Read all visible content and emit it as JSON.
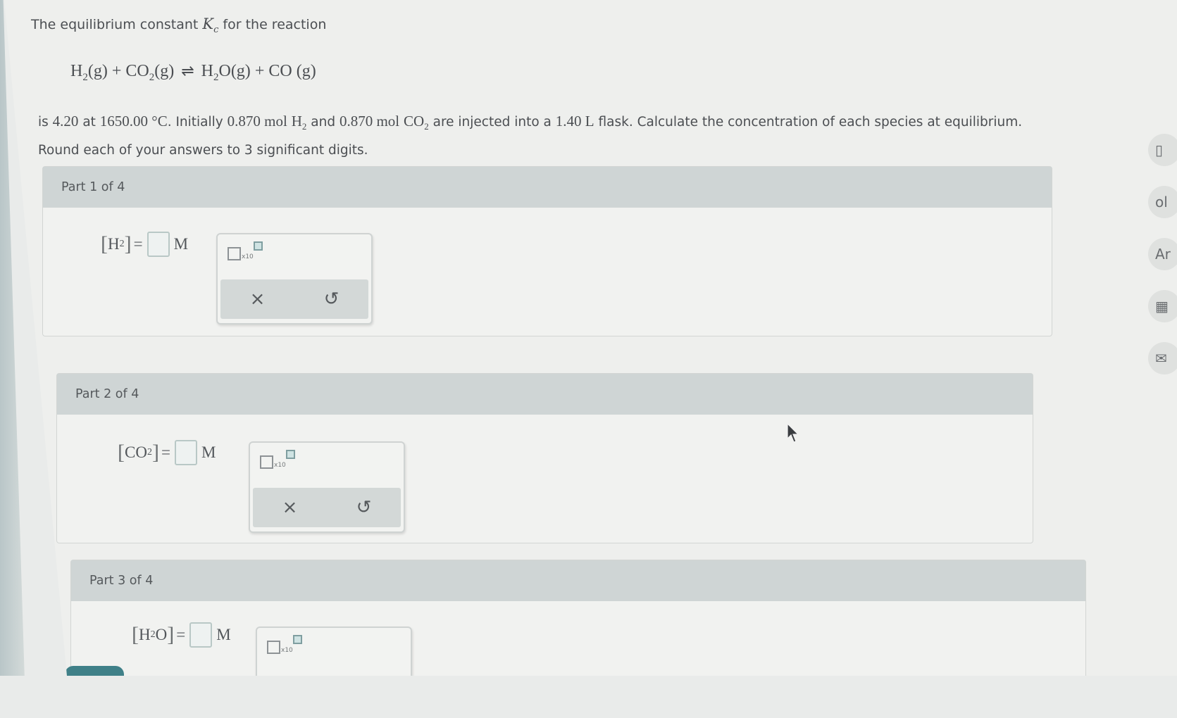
{
  "question": {
    "intro_before": "The equilibrium constant",
    "k_symbol": "K",
    "k_subscript": "c",
    "intro_after": "for the reaction",
    "equation": {
      "r1": "H",
      "r1_sub": "2",
      "r1_state": "(g)",
      "plus1": "+",
      "r2": "CO",
      "r2_sub": "2",
      "r2_state": "(g)",
      "arrow": "⇌",
      "p1": "H",
      "p1_sub": "2",
      "p1_rest": "O(g)",
      "plus2": "+",
      "p2": "CO (g)"
    },
    "line1": {
      "t1": "is",
      "kc_value": "4.20",
      "t2": "at",
      "temperature": "1650.00 °C",
      "t3": ". Initially",
      "h2_amount": "0.870 mol",
      "h2": "H",
      "h2_sub": "2",
      "t4": "and",
      "co2_amount": "0.870 mol",
      "co2": "CO",
      "co2_sub": "2",
      "t5": "are injected into a",
      "volume": "1.40 L",
      "t6": "flask. Calculate the concentration of each species at equilibrium."
    },
    "line2": "Round each of your answers to 3 significant digits."
  },
  "parts": [
    {
      "header": "Part 1 of 4",
      "species": "H",
      "species_sub": "2",
      "species_rest": "",
      "eq": "=",
      "unit": "M",
      "value": ""
    },
    {
      "header": "Part 2 of 4",
      "species": "CO",
      "species_sub": "2",
      "species_rest": "",
      "eq": "=",
      "unit": "M",
      "value": ""
    },
    {
      "header": "Part 3 of 4",
      "species": "H",
      "species_sub": "2",
      "species_rest": "O",
      "eq": "=",
      "unit": "M",
      "value": ""
    }
  ],
  "palette": {
    "x10_label": "x10",
    "clear_icon": "×",
    "undo_icon": "↺"
  },
  "side_tools": [
    {
      "name": "doc-icon",
      "glyph": "▯"
    },
    {
      "name": "data-icon",
      "glyph": "ol"
    },
    {
      "name": "periodic-table-icon",
      "glyph": "Ar"
    },
    {
      "name": "calculator-icon",
      "glyph": "▦"
    },
    {
      "name": "mail-icon",
      "glyph": "✉"
    }
  ]
}
